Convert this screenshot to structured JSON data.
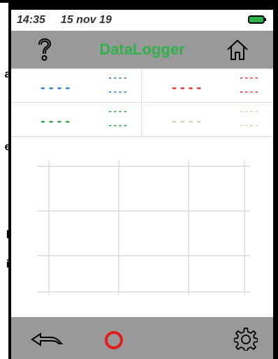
{
  "edge_fragments": {
    "line1": "a",
    "line2": "e",
    "line3": "l",
    "line4": "i"
  },
  "status": {
    "time": "14:35",
    "date": "15 nov 19",
    "battery_icon": "battery-full-icon"
  },
  "header": {
    "title": "DataLogger",
    "help_icon": "question-mark-icon",
    "home_icon": "home-icon"
  },
  "readings": [
    {
      "main": "----",
      "sub1": "----",
      "sub2": "----",
      "color": "#1f6fc1"
    },
    {
      "main": "----",
      "sub1": "----",
      "sub2": "----",
      "color": "#e31b1b"
    },
    {
      "main": "----",
      "sub1": "----",
      "sub2": "----",
      "color": "#1e9e3d"
    },
    {
      "main": "----",
      "sub1": "----",
      "sub2": "----",
      "color": "#c7d6a2"
    }
  ],
  "chart_data": {
    "type": "line",
    "series": [],
    "grid": true,
    "xlabel": "",
    "ylabel": ""
  },
  "footer": {
    "back_icon": "back-arrow-icon",
    "record_icon": "record-icon",
    "settings_icon": "gear-icon"
  },
  "colors": {
    "accent": "#2fb24a",
    "bar_bg": "#999999",
    "record": "#e31b1b"
  }
}
